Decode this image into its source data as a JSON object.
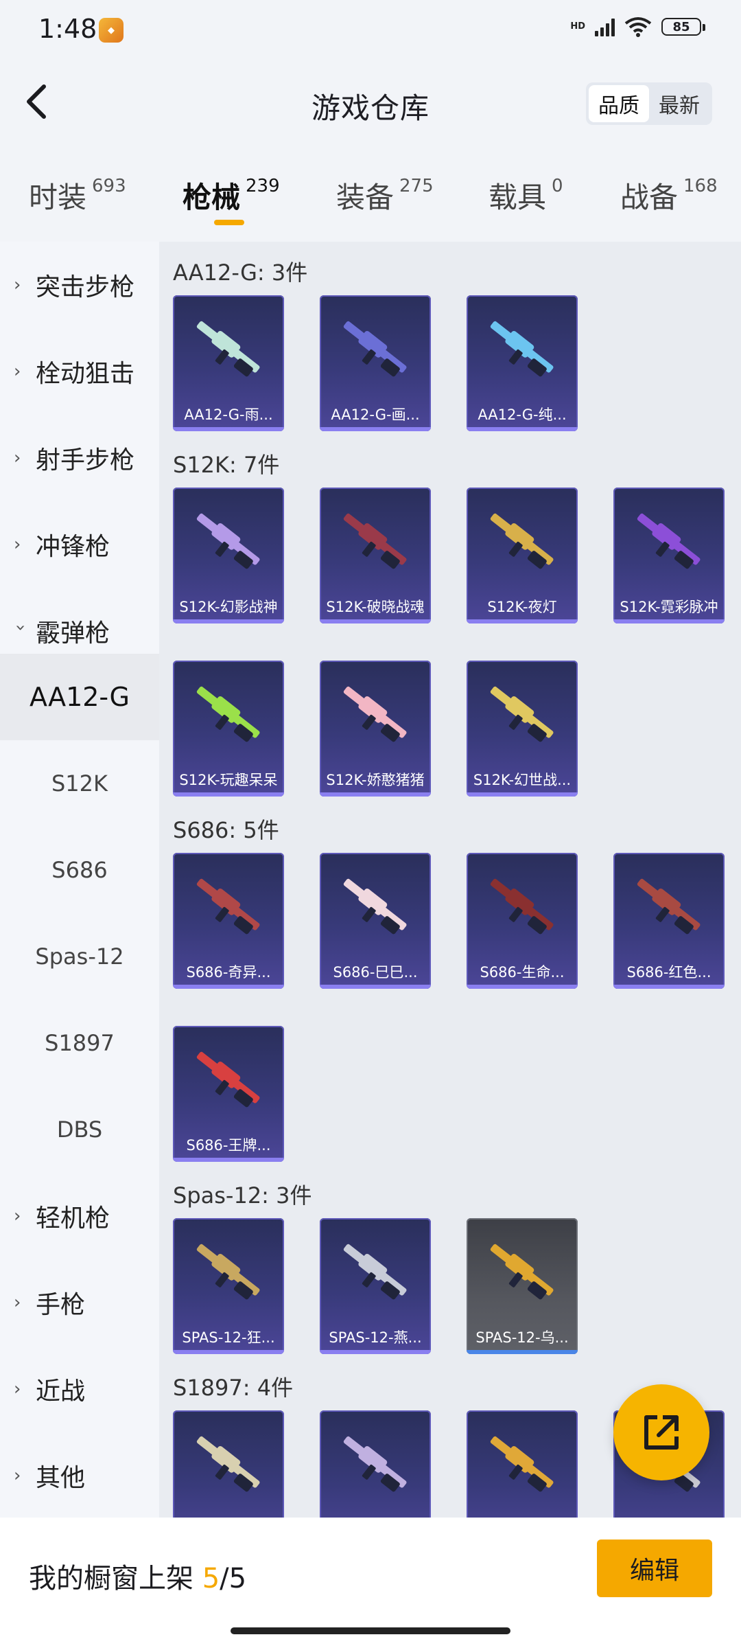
{
  "status_bar": {
    "time": "1:48",
    "hd": "HD",
    "battery": "85"
  },
  "header": {
    "title": "游戏仓库",
    "sort_options": [
      "品质",
      "最新"
    ],
    "sort_selected": "品质",
    "back_icon": "chevron-left-icon"
  },
  "tabs": [
    {
      "label": "时装",
      "count": "693"
    },
    {
      "label": "枪械",
      "count": "239"
    },
    {
      "label": "装备",
      "count": "275"
    },
    {
      "label": "载具",
      "count": "0"
    },
    {
      "label": "战备",
      "count": "168"
    }
  ],
  "active_tab": "枪械",
  "sidebar": {
    "categories": [
      {
        "label": "突击步枪"
      },
      {
        "label": "栓动狙击"
      },
      {
        "label": "射手步枪"
      },
      {
        "label": "冲锋枪"
      },
      {
        "label": "霰弹枪"
      }
    ],
    "subitems": [
      {
        "label": "AA12-G"
      },
      {
        "label": "S12K"
      },
      {
        "label": "S686"
      },
      {
        "label": "Spas-12"
      },
      {
        "label": "S1897"
      },
      {
        "label": "DBS"
      }
    ],
    "active_sub": "AA12-G",
    "more_categories": [
      {
        "label": "轻机枪"
      },
      {
        "label": "手枪"
      },
      {
        "label": "近战"
      },
      {
        "label": "其他"
      }
    ]
  },
  "groups": [
    {
      "title": "AA12-G: 3件",
      "items": [
        {
          "name": "AA12-G-雨...",
          "color": "#bfe4d9"
        },
        {
          "name": "AA12-G-画...",
          "color": "#6b6fd6"
        },
        {
          "name": "AA12-G-纯...",
          "color": "#6cc4f0"
        }
      ]
    },
    {
      "title": "S12K: 7件",
      "items": [
        {
          "name": "S12K-幻影战神",
          "color": "#b49ae8"
        },
        {
          "name": "S12K-破晓战魂",
          "color": "#9a3a4a"
        },
        {
          "name": "S12K-夜灯",
          "color": "#d8b04a"
        },
        {
          "name": "S12K-霓彩脉冲",
          "color": "#8c4fd8"
        },
        {
          "name": "S12K-玩趣呆呆",
          "color": "#9be04a"
        },
        {
          "name": "S12K-娇憨猪猪",
          "color": "#f2b6c4"
        },
        {
          "name": "S12K-幻世战...",
          "color": "#e0c860"
        }
      ]
    },
    {
      "title": "S686: 5件",
      "items": [
        {
          "name": "S686-奇异...",
          "color": "#b04848"
        },
        {
          "name": "S686-巳巳...",
          "color": "#f0d8de"
        },
        {
          "name": "S686-生命...",
          "color": "#8a3030"
        },
        {
          "name": "S686-红色...",
          "color": "#a84a42"
        },
        {
          "name": "S686-王牌...",
          "color": "#d84040"
        }
      ]
    },
    {
      "title": "Spas-12: 3件",
      "items": [
        {
          "name": "SPAS-12-狂...",
          "color": "#c8a860"
        },
        {
          "name": "SPAS-12-燕...",
          "color": "#c8ccd8"
        },
        {
          "name": "SPAS-12-乌...",
          "color": "#e0a830",
          "gray": true
        }
      ]
    },
    {
      "title": "S1897: 4件",
      "items": [
        {
          "name": "",
          "color": "#d8d0b0"
        },
        {
          "name": "",
          "color": "#c0b0e0"
        },
        {
          "name": "",
          "color": "#e0a838"
        },
        {
          "name": "",
          "color": "#c8c8d0"
        }
      ]
    }
  ],
  "fab_icon": "share-external-icon",
  "bottom": {
    "shop_label_prefix": "我的橱窗上架",
    "shop_current": "5",
    "shop_sep": "/5",
    "edit_label": "编辑"
  }
}
